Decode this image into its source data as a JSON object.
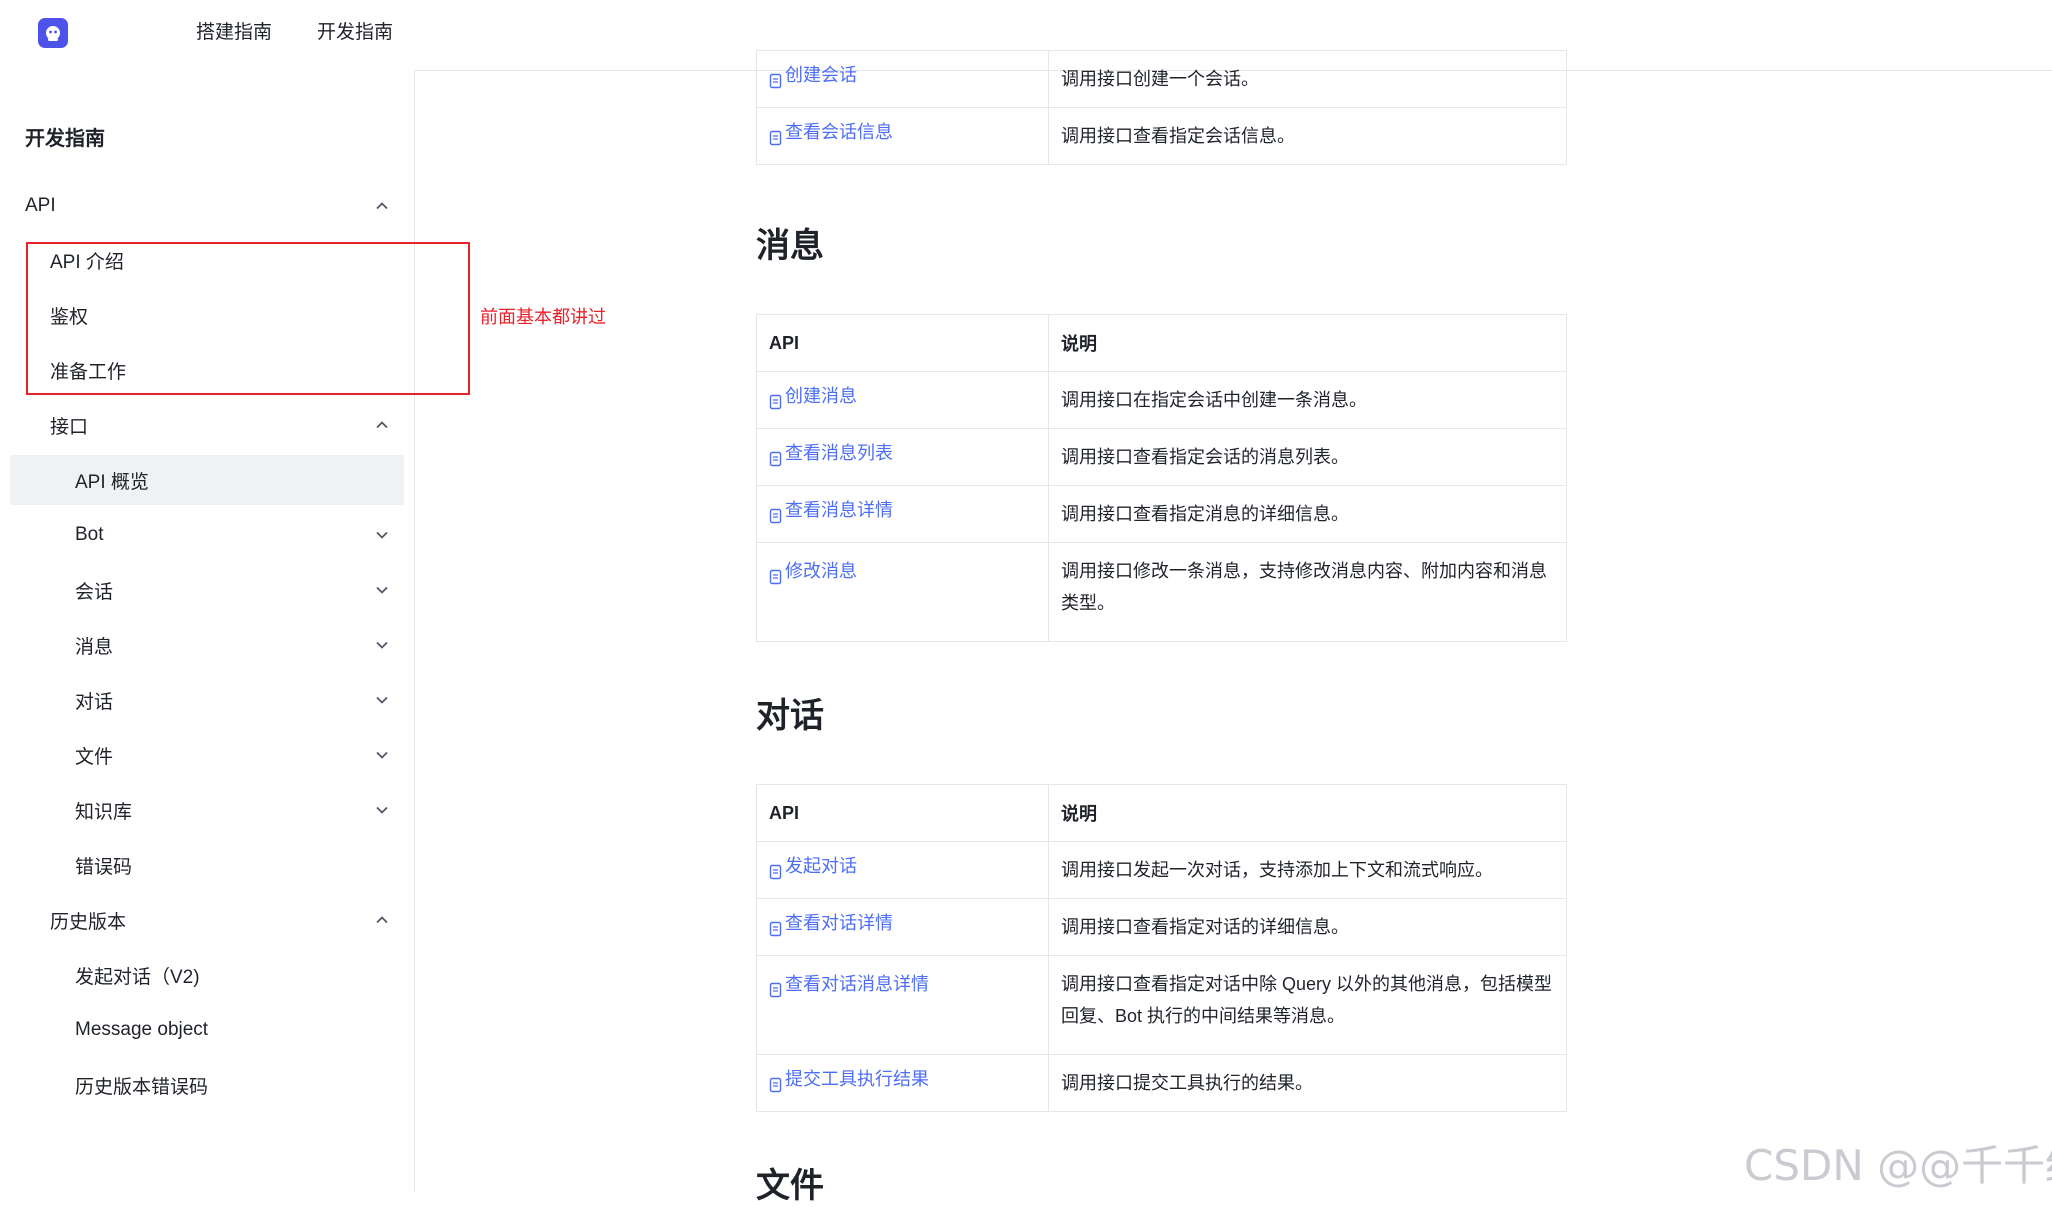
{
  "topbar": {
    "nav": [
      "搭建指南",
      "开发指南"
    ]
  },
  "sidebar": {
    "title": "开发指南",
    "items": [
      {
        "label": "API",
        "chevron": "up"
      },
      {
        "label": "API 介绍"
      },
      {
        "label": "鉴权"
      },
      {
        "label": "准备工作"
      },
      {
        "label": "接口",
        "chevron": "up"
      },
      {
        "label": "API 概览",
        "active": true
      },
      {
        "label": "Bot",
        "chevron": "down"
      },
      {
        "label": "会话",
        "chevron": "down"
      },
      {
        "label": "消息",
        "chevron": "down"
      },
      {
        "label": "对话",
        "chevron": "down"
      },
      {
        "label": "文件",
        "chevron": "down"
      },
      {
        "label": "知识库",
        "chevron": "down"
      },
      {
        "label": "错误码"
      },
      {
        "label": "历史版本",
        "chevron": "up"
      },
      {
        "label": "发起对话（V2)"
      },
      {
        "label": "Message object"
      },
      {
        "label": "历史版本错误码"
      }
    ]
  },
  "annotation": "前面基本都讲过",
  "colors": {
    "accent": "#4d53e8",
    "link": "#4d6ef5",
    "annotation": "#e8222b"
  },
  "main": {
    "session_table": {
      "rows": [
        {
          "api": "创建会话",
          "desc": "调用接口创建一个会话。"
        },
        {
          "api": "查看会话信息",
          "desc": "调用接口查看指定会话信息。"
        }
      ]
    },
    "message_section": {
      "title": "消息",
      "header": {
        "api": "API",
        "desc": "说明"
      },
      "rows": [
        {
          "api": "创建消息",
          "desc": "调用接口在指定会话中创建一条消息。"
        },
        {
          "api": "查看消息列表",
          "desc": "调用接口查看指定会话的消息列表。"
        },
        {
          "api": "查看消息详情",
          "desc": "调用接口查看指定消息的详细信息。"
        },
        {
          "api": "修改消息",
          "desc": "调用接口修改一条消息，支持修改消息内容、附加内容和消息类型。"
        }
      ]
    },
    "chat_section": {
      "title": "对话",
      "header": {
        "api": "API",
        "desc": "说明"
      },
      "rows": [
        {
          "api": "发起对话",
          "desc": "调用接口发起一次对话，支持添加上下文和流式响应。"
        },
        {
          "api": "查看对话详情",
          "desc": "调用接口查看指定对话的详细信息。"
        },
        {
          "api": "查看对话消息详情",
          "desc": "调用接口查看指定对话中除 Query 以外的其他消息，包括模型回复、Bot 执行的中间结果等消息。"
        },
        {
          "api": "提交工具执行结果",
          "desc": "调用接口提交工具执行的结果。"
        }
      ]
    },
    "file_section": {
      "title": "文件"
    }
  },
  "watermark": "CSDN @@千千结"
}
